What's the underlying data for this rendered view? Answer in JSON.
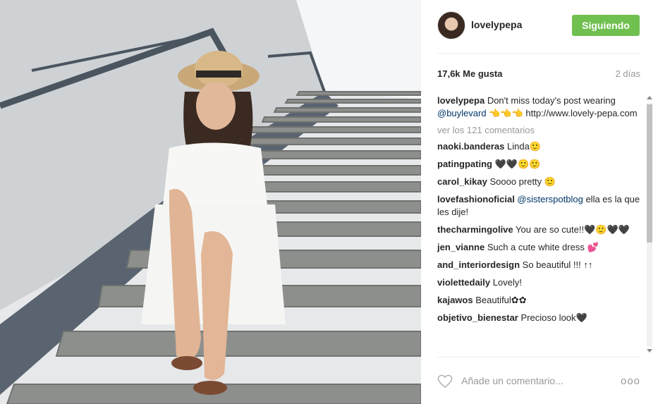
{
  "photo": {
    "alt": "Woman in white dress and straw hat sitting on stairs"
  },
  "header": {
    "username": "lovelypepa",
    "follow_label": "Siguiendo"
  },
  "stats": {
    "likes": "17,6k Me gusta",
    "time": "2 días"
  },
  "caption": {
    "user": "lovelypepa",
    "text1": " Don't miss today's post wearing ",
    "mention": "@buylevard",
    "text2": " 👈👈👈 http://www.lovely-pepa.com"
  },
  "view_all": "ver los 121 comentarios",
  "comments": [
    {
      "user": "naoki.banderas",
      "text": " Linda🙂"
    },
    {
      "user": "patingpating",
      "text": " 🖤🖤🙂🙂"
    },
    {
      "user": "carol_kikay",
      "text": " Soooo pretty 🙂"
    },
    {
      "user": "lovefashionoficial",
      "mention": " @sisterspotblog",
      "text": " ella es la que les dije!"
    },
    {
      "user": "thecharmingolive",
      "text": " You are so cute!!🖤🙂🖤🖤"
    },
    {
      "user": "jen_vianne",
      "text": " Such a cute white dress 💕"
    },
    {
      "user": "and_interiordesign",
      "text": " So beautiful !!! ↑↑"
    },
    {
      "user": "violettedaily",
      "text": " Lovely!"
    },
    {
      "user": "kajawos",
      "text": " Beautiful✿✿"
    },
    {
      "user": "objetivo_bienestar",
      "text": " Precioso look🖤"
    }
  ],
  "footer": {
    "placeholder": "Añade un comentario...",
    "more": "ooo"
  },
  "colors": {
    "follow": "#70c050",
    "mention": "#003569",
    "muted": "#999999"
  }
}
